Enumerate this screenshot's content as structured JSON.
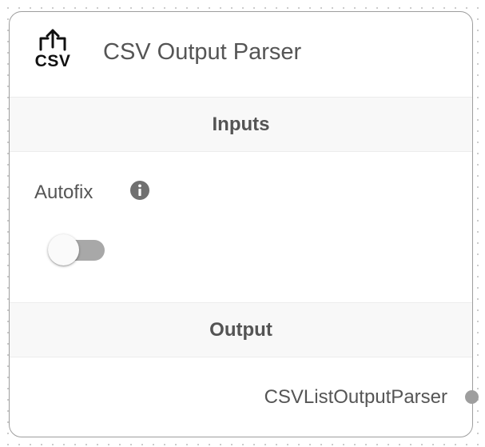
{
  "node": {
    "icon_name": "csv-export-icon",
    "icon_text": "CSV",
    "title": "CSV Output Parser"
  },
  "inputs_section": {
    "title": "Inputs",
    "params": [
      {
        "label": "Autofix",
        "info_icon": "info-icon",
        "type": "toggle",
        "value": false
      }
    ]
  },
  "output_section": {
    "title": "Output",
    "output_label": "CSVListOutputParser"
  },
  "colors": {
    "title_text": "#555555",
    "section_bg": "#f8f8f8",
    "border": "#9e9e9e",
    "toggle_track_off": "#a8a8a8",
    "handle": "#9e9e9e"
  }
}
